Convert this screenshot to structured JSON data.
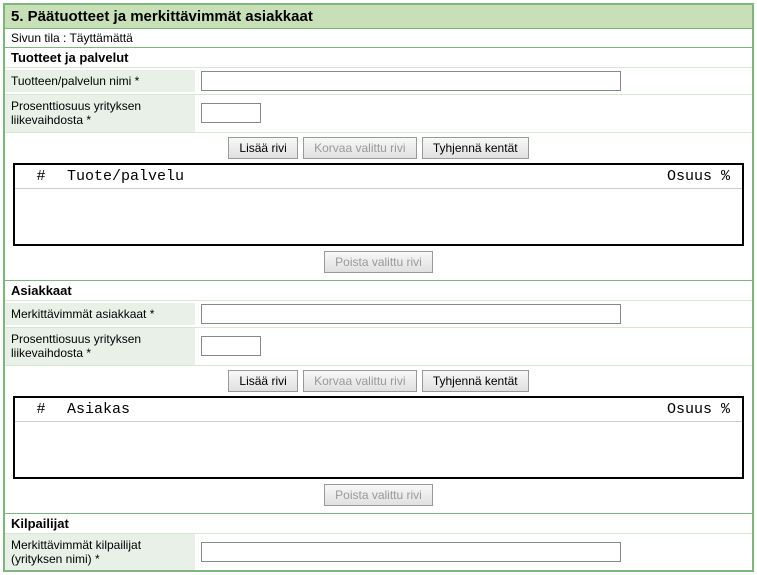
{
  "header": {
    "title": "5. Päätuotteet ja merkittävimmät asiakkaat"
  },
  "status": {
    "text": "Sivun tila : Täyttämättä"
  },
  "products": {
    "title": "Tuotteet ja palvelut",
    "name_label": "Tuotteen/palvelun nimi *",
    "percent_label": "Prosenttiosuus yrityksen liikevaihdosta *",
    "buttons": {
      "add": "Lisää rivi",
      "replace": "Korvaa valittu rivi",
      "clear": "Tyhjennä kentät",
      "delete": "Poista valittu rivi"
    },
    "table": {
      "col_num": "#",
      "col_main": "Tuote/palvelu",
      "col_share": "Osuus %"
    }
  },
  "customers": {
    "title": "Asiakkaat",
    "name_label": "Merkittävimmät asiakkaat *",
    "percent_label": "Prosenttiosuus yrityksen liikevaihdosta *",
    "buttons": {
      "add": "Lisää rivi",
      "replace": "Korvaa valittu rivi",
      "clear": "Tyhjennä kentät",
      "delete": "Poista valittu rivi"
    },
    "table": {
      "col_num": "#",
      "col_main": "Asiakas",
      "col_share": "Osuus %"
    }
  },
  "competitors": {
    "title": "Kilpailijat",
    "name_label": "Merkittävimmät kilpailijat (yrityksen nimi) *"
  }
}
